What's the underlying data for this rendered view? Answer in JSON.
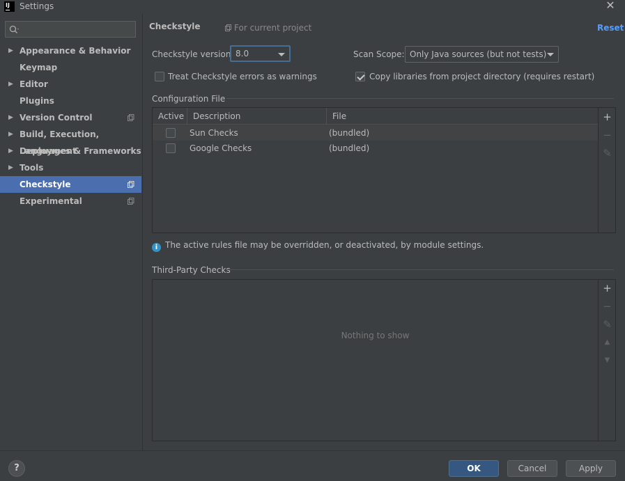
{
  "window": {
    "title": "Settings",
    "logo_text": "IJ",
    "close_icon": "close-icon"
  },
  "search": {
    "placeholder": "",
    "icon": "search-icon"
  },
  "sidebar": {
    "items": [
      {
        "label": "Appearance & Behavior",
        "expandable": true,
        "project_icon": false,
        "selected": false
      },
      {
        "label": "Keymap",
        "expandable": false,
        "project_icon": false,
        "selected": false
      },
      {
        "label": "Editor",
        "expandable": true,
        "project_icon": false,
        "selected": false
      },
      {
        "label": "Plugins",
        "expandable": false,
        "project_icon": false,
        "selected": false
      },
      {
        "label": "Version Control",
        "expandable": true,
        "project_icon": true,
        "selected": false
      },
      {
        "label": "Build, Execution, Deployment",
        "expandable": true,
        "project_icon": false,
        "selected": false
      },
      {
        "label": "Languages & Frameworks",
        "expandable": true,
        "project_icon": false,
        "selected": false
      },
      {
        "label": "Tools",
        "expandable": true,
        "project_icon": false,
        "selected": false
      },
      {
        "label": "Checkstyle",
        "expandable": false,
        "project_icon": true,
        "selected": true
      },
      {
        "label": "Experimental",
        "expandable": false,
        "project_icon": true,
        "selected": false
      }
    ]
  },
  "header": {
    "title": "Checkstyle",
    "scope_note": "For current project",
    "reset_label": "Reset"
  },
  "settings": {
    "version_label": "Checkstyle version:",
    "version_value": "8.0",
    "scan_scope_label": "Scan Scope:",
    "scan_scope_value": "Only Java sources (but not tests)",
    "treat_errors_label": "Treat Checkstyle errors as warnings",
    "treat_errors_checked": false,
    "copy_libs_label": "Copy libraries from project directory (requires restart)",
    "copy_libs_checked": true
  },
  "config_file": {
    "section_title": "Configuration File",
    "columns": [
      "Active",
      "Description",
      "File"
    ],
    "rows": [
      {
        "active": false,
        "description": "Sun Checks",
        "file": "(bundled)"
      },
      {
        "active": false,
        "description": "Google Checks",
        "file": "(bundled)"
      }
    ],
    "toolbar": {
      "add": "+",
      "remove": "−",
      "edit": "✎"
    }
  },
  "info": {
    "text": "The active rules file may be overridden, or deactivated, by module settings."
  },
  "third_party": {
    "section_title": "Third-Party Checks",
    "empty_text": "Nothing to show",
    "toolbar": {
      "add": "+",
      "remove": "−",
      "edit": "✎",
      "up": "▲",
      "down": "▼"
    }
  },
  "footer": {
    "help": "?",
    "ok": "OK",
    "cancel": "Cancel",
    "apply": "Apply"
  },
  "colors": {
    "selection": "#4b6eaf",
    "link": "#589df6",
    "primary_button": "#365880",
    "info_icon": "#3592c4"
  }
}
